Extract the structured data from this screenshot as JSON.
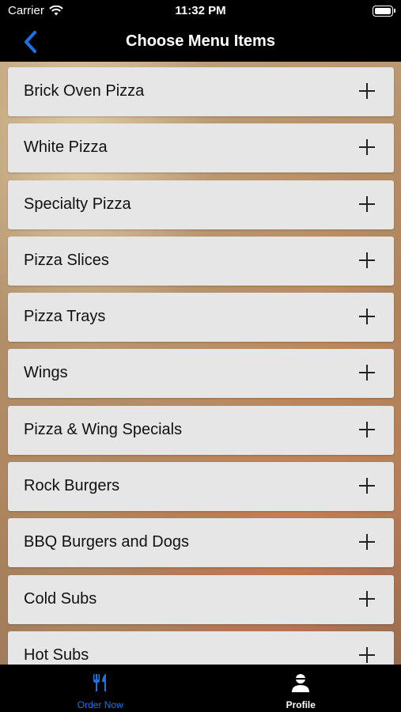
{
  "status_bar": {
    "carrier": "Carrier",
    "time": "11:32 PM",
    "icons": [
      "wifi-icon",
      "battery-icon"
    ]
  },
  "nav": {
    "title": "Choose Menu Items",
    "back_icon": "chevron-left-icon",
    "accent_color": "#1a73e8"
  },
  "menu": {
    "items": [
      {
        "label": "Brick Oven Pizza"
      },
      {
        "label": "White Pizza"
      },
      {
        "label": "Specialty Pizza"
      },
      {
        "label": "Pizza Slices"
      },
      {
        "label": "Pizza Trays"
      },
      {
        "label": "Wings"
      },
      {
        "label": "Pizza & Wing Specials"
      },
      {
        "label": "Rock Burgers"
      },
      {
        "label": "BBQ Burgers and Dogs"
      },
      {
        "label": "Cold Subs"
      },
      {
        "label": "Hot Subs"
      }
    ],
    "expand_icon": "plus-icon"
  },
  "tabs": [
    {
      "label": "Order Now",
      "icon": "utensils-icon",
      "active": true
    },
    {
      "label": "Profile",
      "icon": "user-icon",
      "active": false
    }
  ]
}
